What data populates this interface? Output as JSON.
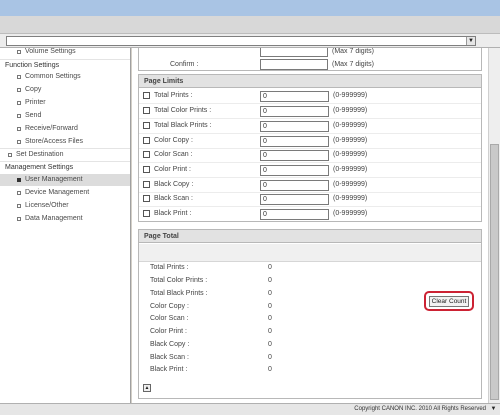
{
  "sidebar": {
    "items": [
      {
        "label": "Volume Settings",
        "kind": "sub"
      },
      {
        "label": "Function Settings",
        "kind": "head"
      },
      {
        "label": "Common Settings",
        "kind": "sub"
      },
      {
        "label": "Copy",
        "kind": "sub"
      },
      {
        "label": "Printer",
        "kind": "sub"
      },
      {
        "label": "Send",
        "kind": "sub"
      },
      {
        "label": "Receive/Forward",
        "kind": "sub"
      },
      {
        "label": "Store/Access Files",
        "kind": "sub"
      },
      {
        "label": "Set Destination",
        "kind": "top"
      },
      {
        "label": "Management Settings",
        "kind": "head"
      },
      {
        "label": "User Management",
        "kind": "sub",
        "selected": true
      },
      {
        "label": "Device Management",
        "kind": "sub"
      },
      {
        "label": "License/Other",
        "kind": "sub"
      },
      {
        "label": "Data Management",
        "kind": "sub"
      }
    ]
  },
  "password": {
    "partial_hint": "(Max 7 digits)",
    "confirm_label": "Confirm :",
    "confirm_hint": "(Max 7 digits)"
  },
  "page_limits": {
    "title": "Page Limits",
    "rows": [
      {
        "label": "Total Prints :",
        "value": "0",
        "range": "(0-999999)"
      },
      {
        "label": "Total Color Prints :",
        "value": "0",
        "range": "(0-999999)"
      },
      {
        "label": "Total Black Prints :",
        "value": "0",
        "range": "(0-999999)"
      },
      {
        "label": "Color Copy :",
        "value": "0",
        "range": "(0-999999)"
      },
      {
        "label": "Color Scan :",
        "value": "0",
        "range": "(0-999999)"
      },
      {
        "label": "Color Print :",
        "value": "0",
        "range": "(0-999999)"
      },
      {
        "label": "Black Copy :",
        "value": "0",
        "range": "(0-999999)"
      },
      {
        "label": "Black Scan :",
        "value": "0",
        "range": "(0-999999)"
      },
      {
        "label": "Black Print :",
        "value": "0",
        "range": "(0-999999)"
      }
    ]
  },
  "page_total": {
    "title": "Page Total",
    "clear_button": "Clear Count",
    "rows": [
      {
        "label": "Total Prints :",
        "value": "0"
      },
      {
        "label": "Total Color Prints :",
        "value": "0"
      },
      {
        "label": "Total Black Prints :",
        "value": "0"
      },
      {
        "label": "Color Copy :",
        "value": "0"
      },
      {
        "label": "Color Scan :",
        "value": "0"
      },
      {
        "label": "Color Print :",
        "value": "0"
      },
      {
        "label": "Black Copy :",
        "value": "0"
      },
      {
        "label": "Black Scan :",
        "value": "0"
      },
      {
        "label": "Black Print :",
        "value": "0"
      }
    ]
  },
  "footer": {
    "copyright": "Copyright CANON INC. 2010 All Rights Reserved"
  },
  "colors": {
    "highlight_ring": "#cc2233",
    "section_header": "#e2e2e2",
    "title_bar": "#a9c4e4"
  }
}
